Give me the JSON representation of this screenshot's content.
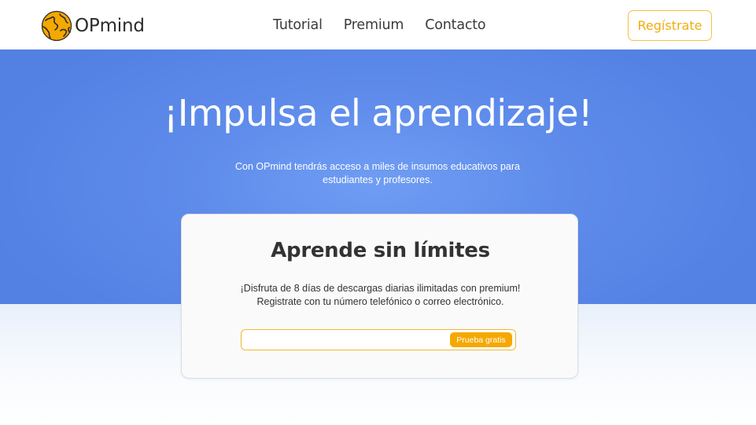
{
  "header": {
    "logo_text": "OPmind",
    "logo_icon": "globe-icon",
    "nav": [
      {
        "label": "Tutorial"
      },
      {
        "label": "Premium"
      },
      {
        "label": "Contacto"
      }
    ],
    "register_label": "Regístrate"
  },
  "hero": {
    "title": "¡Impulsa el aprendizaje!",
    "subtitle_line1": "Con OPmind tendrás acceso a miles de insumos educativos para",
    "subtitle_line2": "estudiantes y profesores."
  },
  "card": {
    "title": "Aprende sin límites",
    "text_line1": "¡Disfruta de 8 días de descargas diarias ilimitadas con premium!",
    "text_line2": "Registrate con tu número telefónico o correo electrónico.",
    "input_value": "",
    "input_placeholder": "",
    "button_label": "Prueba gratis"
  },
  "colors": {
    "accent": "#f5a800",
    "hero_blue": "#5f8ceb",
    "text_dark": "#333333"
  }
}
